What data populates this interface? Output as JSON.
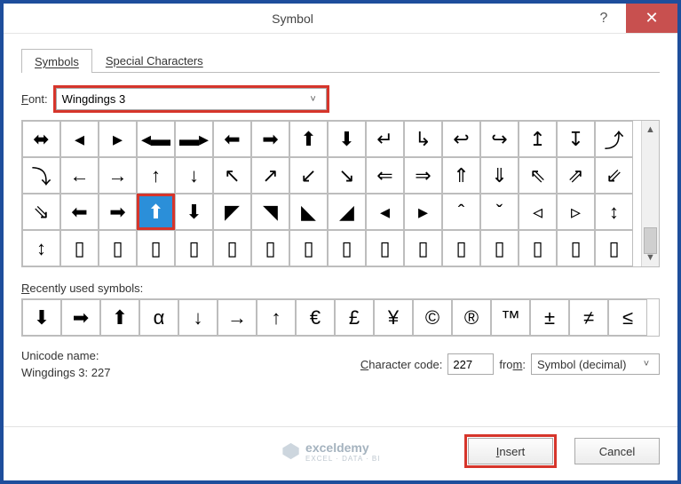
{
  "titlebar": {
    "title": "Symbol",
    "help_tip": "?",
    "close_tip": "✕"
  },
  "tabs": {
    "symbols": "Symbols",
    "special": "Special Characters"
  },
  "fontrow": {
    "label": "Font:",
    "value": "Wingdings 3",
    "chevron": "˅"
  },
  "grid": [
    [
      "⬌",
      "◂",
      "▸",
      "◂▬",
      "▬▸",
      "⬅",
      "➡",
      "⬆",
      "⬇",
      "↵",
      "↳",
      "↩",
      "↪",
      "↥",
      "↧",
      "⤴"
    ],
    [
      "⤵",
      "←",
      "→",
      "↑",
      "↓",
      "↖",
      "↗",
      "↙",
      "↘",
      "⇐",
      "⇒",
      "⇑",
      "⇓",
      "⇖",
      "⇗",
      "⇙"
    ],
    [
      "⇘",
      "⬅",
      "➡",
      "⬆",
      "⬇",
      "◤",
      "◥",
      "◣",
      "◢",
      "◂",
      "▸",
      "ˆ",
      "ˇ",
      "◃",
      "▹",
      "↕"
    ],
    [
      "↕",
      "▯",
      "▯",
      "▯",
      "▯",
      "▯",
      "▯",
      "▯",
      "▯",
      "▯",
      "▯",
      "▯",
      "▯",
      "▯",
      "▯",
      "▯"
    ]
  ],
  "grid_selected": {
    "row": 2,
    "col": 3
  },
  "recent_label": "Recently used symbols:",
  "recent": [
    "⬇",
    "➡",
    "⬆",
    "α",
    "↓",
    "→",
    "↑",
    "€",
    "£",
    "¥",
    "©",
    "®",
    "™",
    "±",
    "≠",
    "≤"
  ],
  "unicode": {
    "label": "Unicode name:",
    "value": "Wingdings 3: 227"
  },
  "charcode": {
    "label": "Character code:",
    "value": "227"
  },
  "from": {
    "label": "from:",
    "value": "Symbol (decimal)",
    "chevron": "˅"
  },
  "footer": {
    "insert": "Insert",
    "cancel": "Cancel"
  },
  "watermark": {
    "brand": "exceldemy",
    "sub": "EXCEL · DATA · BI"
  }
}
